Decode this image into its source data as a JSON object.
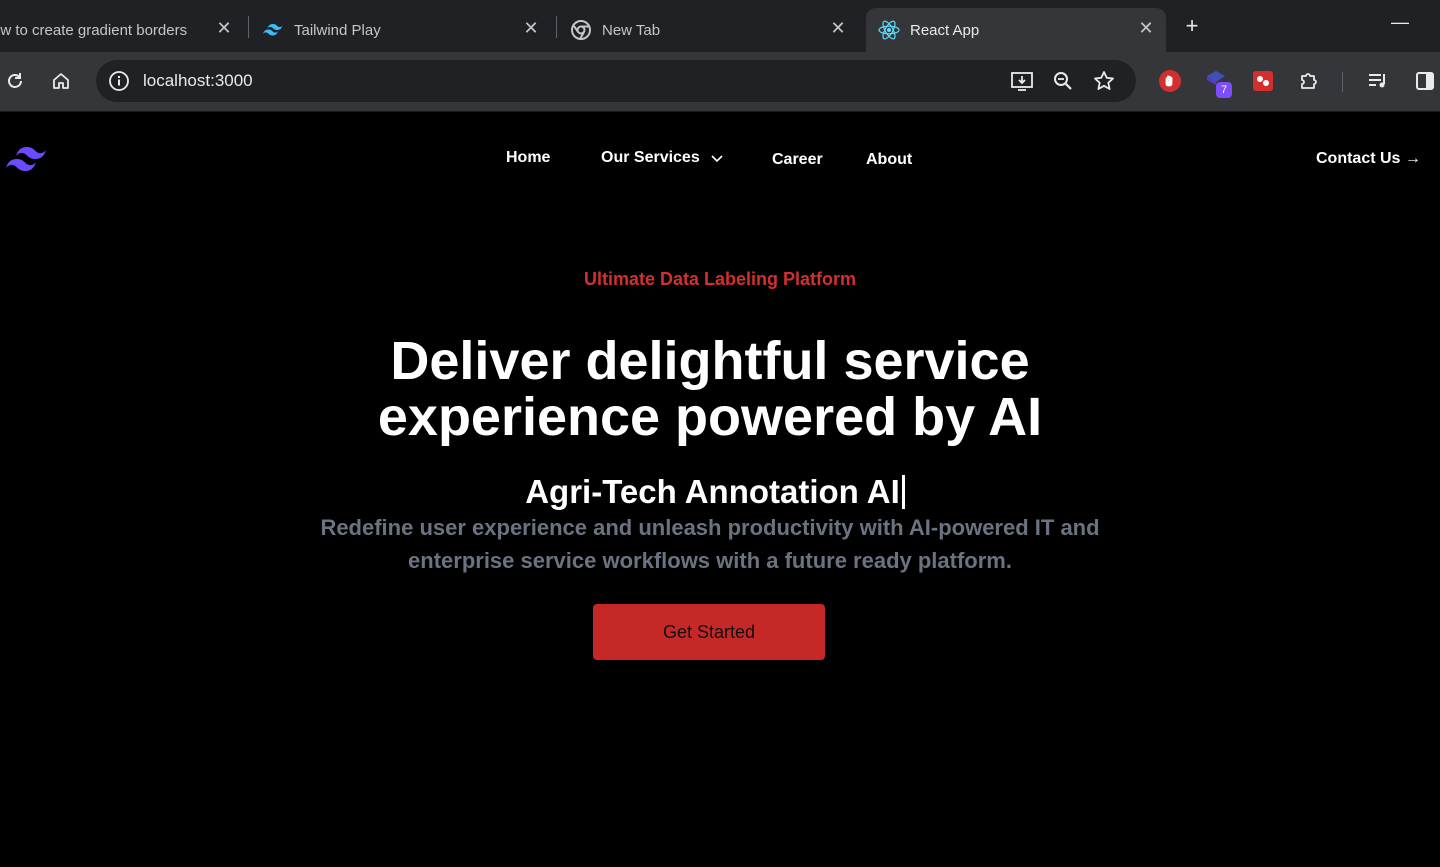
{
  "browser": {
    "tabs": [
      {
        "title": "ow to create gradient borders",
        "icon": "page-icon"
      },
      {
        "title": "Tailwind Play",
        "icon": "tailwind-icon"
      },
      {
        "title": "New Tab",
        "icon": "chrome-icon"
      },
      {
        "title": "React App",
        "icon": "react-icon",
        "active": true
      }
    ],
    "new_tab_label": "+",
    "close_label": "✕",
    "minimize_label": "—",
    "url": "localhost:3000",
    "extension_badge": "7"
  },
  "site": {
    "nav": {
      "home": "Home",
      "services": "Our Services",
      "career": "Career",
      "about": "About",
      "contact": "Contact Us →"
    },
    "hero": {
      "eyebrow": "Ultimate Data Labeling Platform",
      "headline_line1": "Deliver delightful service",
      "headline_line2": "experience powered by AI",
      "typing_text": "Agri-Tech Annotation AI",
      "subtext": "Redefine user experience and unleash productivity with AI-powered IT and enterprise service workflows with a future ready platform.",
      "cta": "Get Started"
    },
    "colors": {
      "accent_red": "#d32f2f",
      "button_red": "#c62828",
      "muted_text": "#6b7280",
      "logo_purple": "#6d4aff"
    }
  }
}
